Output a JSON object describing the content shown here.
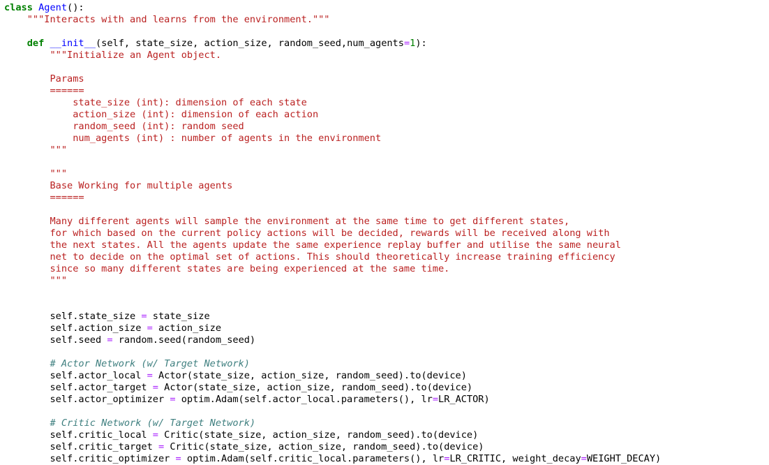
{
  "code_lines": [
    {
      "segments": [
        {
          "t": "class",
          "c": "kw"
        },
        {
          "t": " "
        },
        {
          "t": "Agent",
          "c": "cls"
        },
        {
          "t": "():"
        }
      ]
    },
    {
      "segments": [
        {
          "t": "    \"\"\"Interacts with and learns from the environment.\"\"\"",
          "c": "str"
        }
      ]
    },
    {
      "segments": []
    },
    {
      "segments": [
        {
          "t": "    "
        },
        {
          "t": "def",
          "c": "kw"
        },
        {
          "t": " "
        },
        {
          "t": "__init__",
          "c": "fn"
        },
        {
          "t": "(self, state_size, action_size, random_seed,num_agents"
        },
        {
          "t": "=",
          "c": "op"
        },
        {
          "t": "1",
          "c": "num"
        },
        {
          "t": "):"
        }
      ]
    },
    {
      "segments": [
        {
          "t": "        \"\"\"Initialize an Agent object.",
          "c": "str"
        }
      ]
    },
    {
      "segments": []
    },
    {
      "segments": [
        {
          "t": "        Params",
          "c": "str"
        }
      ]
    },
    {
      "segments": [
        {
          "t": "        ======",
          "c": "str"
        }
      ]
    },
    {
      "segments": [
        {
          "t": "            state_size (int): dimension of each state",
          "c": "str"
        }
      ]
    },
    {
      "segments": [
        {
          "t": "            action_size (int): dimension of each action",
          "c": "str"
        }
      ]
    },
    {
      "segments": [
        {
          "t": "            random_seed (int): random seed",
          "c": "str"
        }
      ]
    },
    {
      "segments": [
        {
          "t": "            num_agents (int) : number of agents in the environment",
          "c": "str"
        }
      ]
    },
    {
      "segments": [
        {
          "t": "        \"\"\"",
          "c": "str"
        }
      ]
    },
    {
      "segments": []
    },
    {
      "segments": [
        {
          "t": "        \"\"\"",
          "c": "str"
        }
      ]
    },
    {
      "segments": [
        {
          "t": "        Base Working for multiple agents",
          "c": "str"
        }
      ]
    },
    {
      "segments": [
        {
          "t": "        ======",
          "c": "str"
        }
      ]
    },
    {
      "segments": []
    },
    {
      "segments": [
        {
          "t": "        Many different agents will sample the environment at the same time to get different states,",
          "c": "str"
        }
      ]
    },
    {
      "segments": [
        {
          "t": "        for which based on the current policy actions will be decided, rewards will be received along with",
          "c": "str"
        }
      ]
    },
    {
      "segments": [
        {
          "t": "        the next states. All the agents update the same experience replay buffer and utilise the same neural",
          "c": "str"
        }
      ]
    },
    {
      "segments": [
        {
          "t": "        net to decide on the optimal set of actions. This should theoretically increase training efficiency",
          "c": "str"
        }
      ]
    },
    {
      "segments": [
        {
          "t": "        since so many different states are being experienced at the same time.",
          "c": "str"
        }
      ]
    },
    {
      "segments": [
        {
          "t": "        \"\"\"",
          "c": "str"
        }
      ]
    },
    {
      "segments": []
    },
    {
      "segments": []
    },
    {
      "segments": [
        {
          "t": "        self.state_size "
        },
        {
          "t": "=",
          "c": "op"
        },
        {
          "t": " state_size"
        }
      ]
    },
    {
      "segments": [
        {
          "t": "        self.action_size "
        },
        {
          "t": "=",
          "c": "op"
        },
        {
          "t": " action_size"
        }
      ]
    },
    {
      "segments": [
        {
          "t": "        self.seed "
        },
        {
          "t": "=",
          "c": "op"
        },
        {
          "t": " random.seed(random_seed)"
        }
      ]
    },
    {
      "segments": []
    },
    {
      "segments": [
        {
          "t": "        "
        },
        {
          "t": "# Actor Network (w/ Target Network)",
          "c": "cm"
        }
      ]
    },
    {
      "segments": [
        {
          "t": "        self.actor_local "
        },
        {
          "t": "=",
          "c": "op"
        },
        {
          "t": " Actor(state_size, action_size, random_seed).to(device)"
        }
      ]
    },
    {
      "segments": [
        {
          "t": "        self.actor_target "
        },
        {
          "t": "=",
          "c": "op"
        },
        {
          "t": " Actor(state_size, action_size, random_seed).to(device)"
        }
      ]
    },
    {
      "segments": [
        {
          "t": "        self.actor_optimizer "
        },
        {
          "t": "=",
          "c": "op"
        },
        {
          "t": " optim.Adam(self.actor_local.parameters(), lr"
        },
        {
          "t": "=",
          "c": "op"
        },
        {
          "t": "LR_ACTOR)"
        }
      ]
    },
    {
      "segments": []
    },
    {
      "segments": [
        {
          "t": "        "
        },
        {
          "t": "# Critic Network (w/ Target Network)",
          "c": "cm"
        }
      ]
    },
    {
      "segments": [
        {
          "t": "        self.critic_local "
        },
        {
          "t": "=",
          "c": "op"
        },
        {
          "t": " Critic(state_size, action_size, random_seed).to(device)"
        }
      ]
    },
    {
      "segments": [
        {
          "t": "        self.critic_target "
        },
        {
          "t": "=",
          "c": "op"
        },
        {
          "t": " Critic(state_size, action_size, random_seed).to(device)"
        }
      ]
    },
    {
      "segments": [
        {
          "t": "        self.critic_optimizer "
        },
        {
          "t": "=",
          "c": "op"
        },
        {
          "t": " optim.Adam(self.critic_local.parameters(), lr"
        },
        {
          "t": "=",
          "c": "op"
        },
        {
          "t": "LR_CRITIC, weight_decay"
        },
        {
          "t": "=",
          "c": "op"
        },
        {
          "t": "WEIGHT_DECAY)"
        }
      ]
    }
  ],
  "colors": {
    "keyword": "#008000",
    "class_name": "#0000ff",
    "string": "#ba2121",
    "number": "#008000",
    "operator": "#aa22ff",
    "comment": "#408080"
  }
}
